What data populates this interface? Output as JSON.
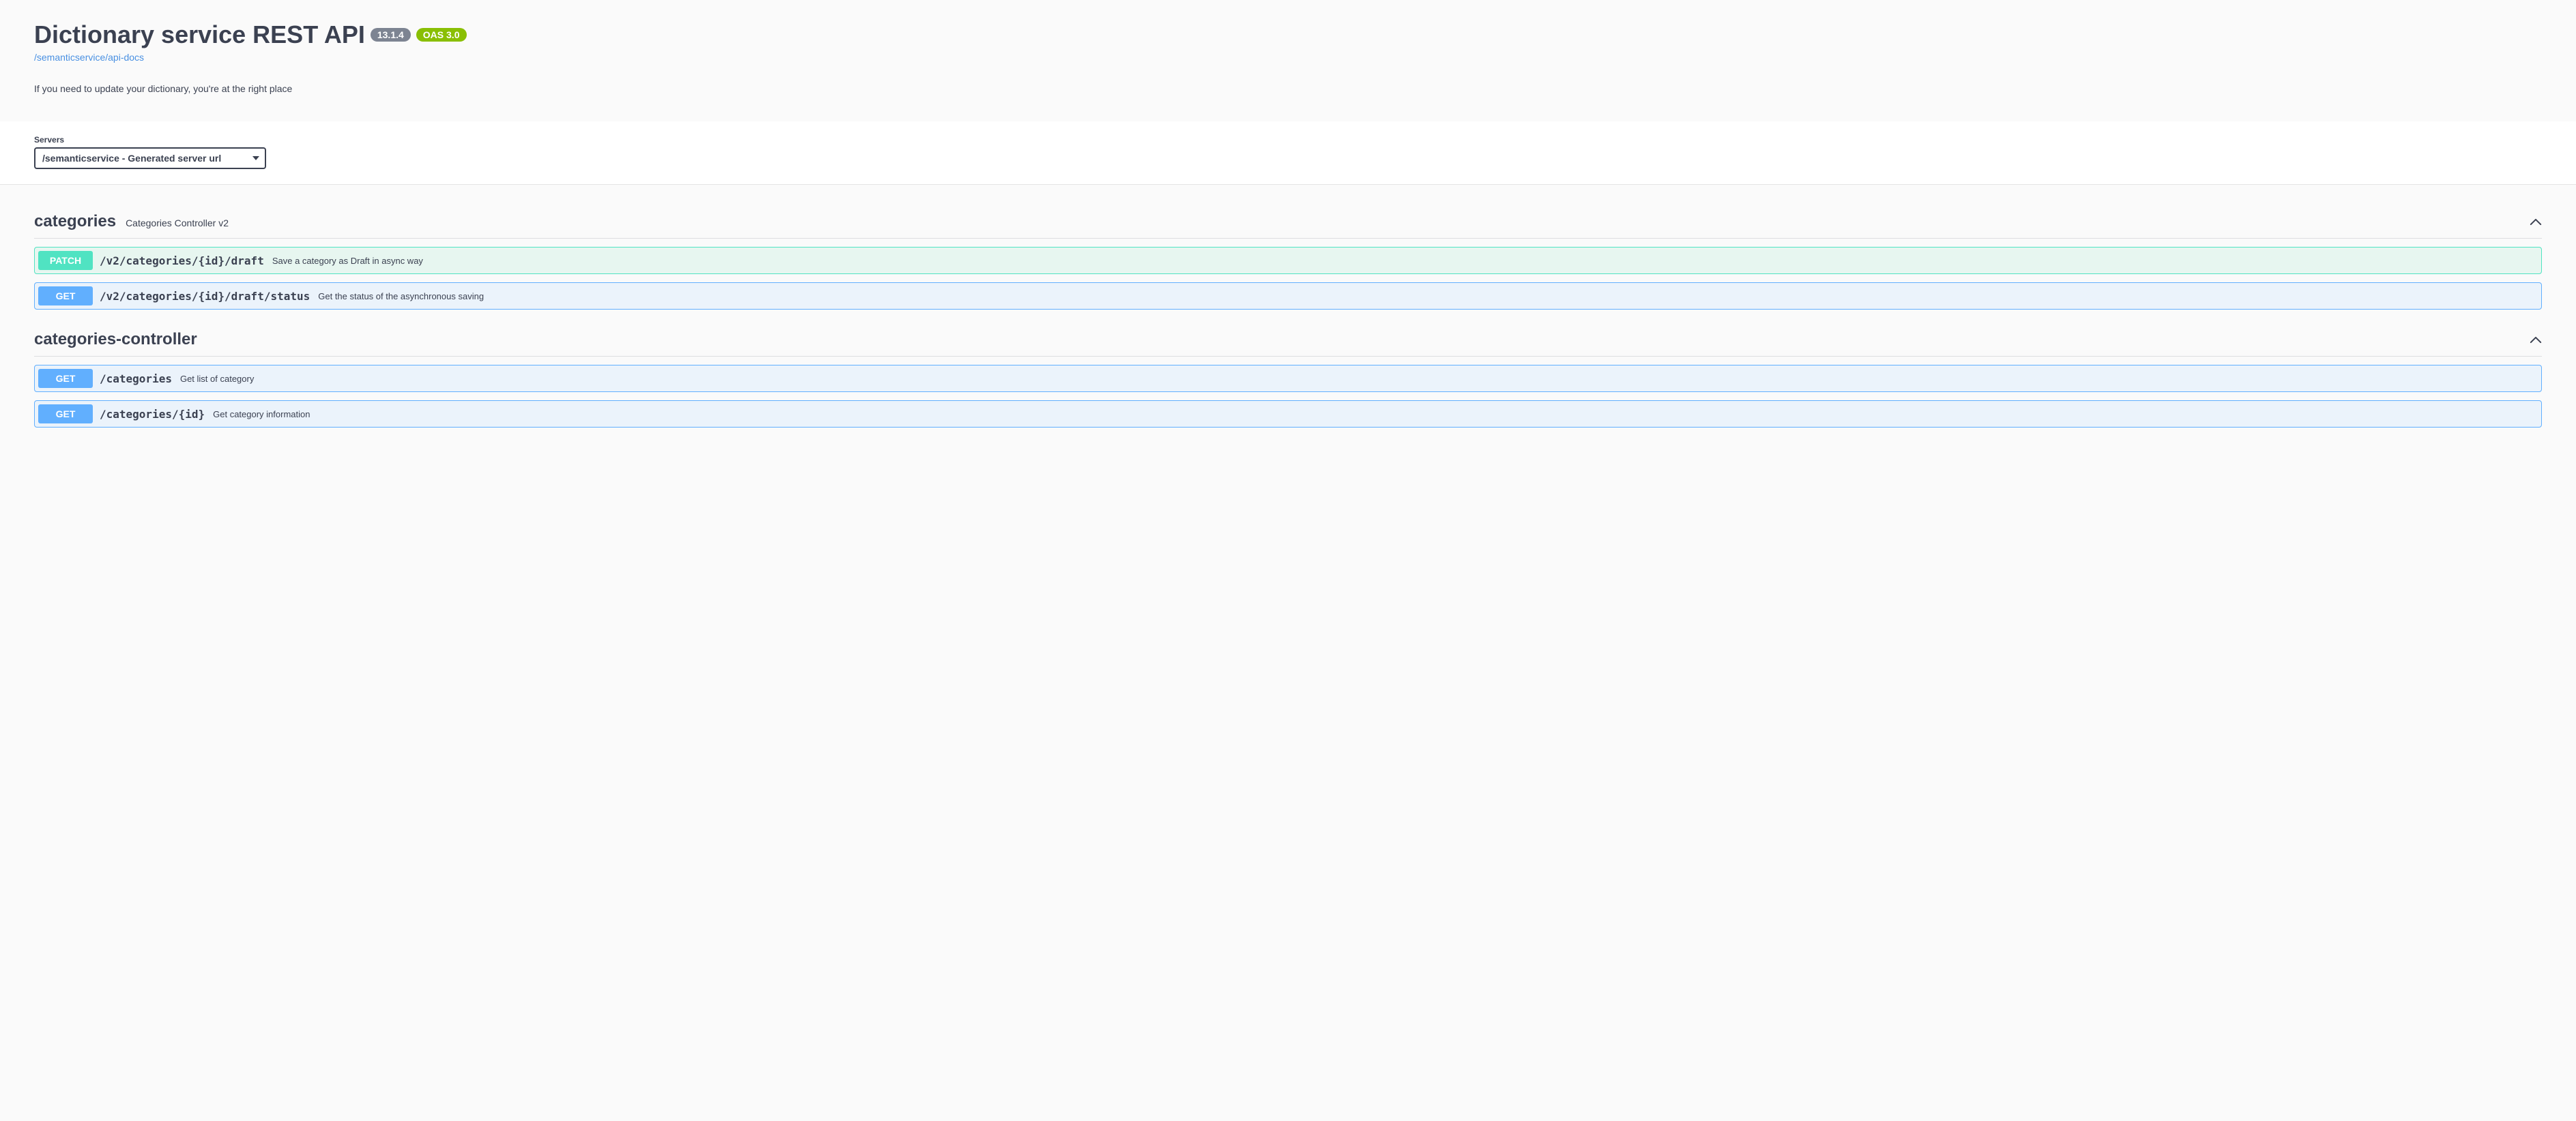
{
  "header": {
    "title": "Dictionary service REST API",
    "version": "13.1.4",
    "oas": "OAS 3.0",
    "docs_link": "/semanticservice/api-docs",
    "description": "If you need to update your dictionary, you're at the right place"
  },
  "servers": {
    "label": "Servers",
    "selected": "/semanticservice - Generated server url"
  },
  "tags": [
    {
      "name": "categories",
      "description": "Categories Controller v2",
      "ops": [
        {
          "method": "PATCH",
          "path": "/v2/categories/{id}/draft",
          "summary": "Save a category as Draft in async way"
        },
        {
          "method": "GET",
          "path": "/v2/categories/{id}/draft/status",
          "summary": "Get the status of the asynchronous saving"
        }
      ]
    },
    {
      "name": "categories-controller",
      "description": "",
      "ops": [
        {
          "method": "GET",
          "path": "/categories",
          "summary": "Get list of category"
        },
        {
          "method": "GET",
          "path": "/categories/{id}",
          "summary": "Get category information"
        }
      ]
    }
  ]
}
